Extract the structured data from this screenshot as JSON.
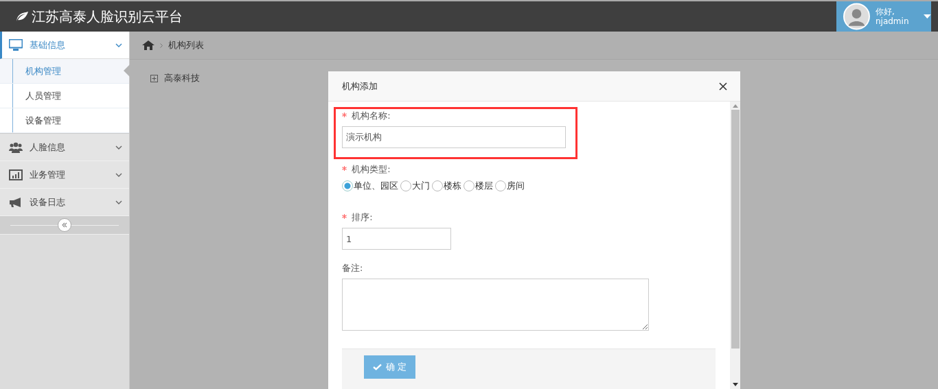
{
  "header": {
    "title": "江苏高泰人脸识别云平台",
    "greeting": "你好,",
    "username": "njadmin"
  },
  "sidebar": {
    "items": [
      {
        "label": "基础信息",
        "expanded": true,
        "children": [
          {
            "label": "机构管理",
            "selected": true
          },
          {
            "label": "人员管理",
            "selected": false
          },
          {
            "label": "设备管理",
            "selected": false
          }
        ]
      },
      {
        "label": "人脸信息",
        "expanded": false
      },
      {
        "label": "业务管理",
        "expanded": false
      },
      {
        "label": "设备日志",
        "expanded": false
      }
    ]
  },
  "breadcrumb": {
    "items": [
      "机构列表"
    ]
  },
  "tree": {
    "nodes": [
      {
        "label": "高泰科技",
        "expanded": false
      }
    ]
  },
  "dialog": {
    "title": "机构添加",
    "fields": [
      {
        "kind": "text",
        "label": "机构名称:",
        "required": true,
        "value": "演示机构",
        "highlighted": true
      },
      {
        "kind": "radio",
        "label": "机构类型:",
        "required": true,
        "options": [
          {
            "label": "单位、园区",
            "selected": true
          },
          {
            "label": "大门",
            "selected": false
          },
          {
            "label": "楼栋",
            "selected": false
          },
          {
            "label": "楼层",
            "selected": false
          },
          {
            "label": "房间",
            "selected": false
          }
        ]
      },
      {
        "kind": "short",
        "label": "排序:",
        "required": true,
        "value": "1"
      },
      {
        "kind": "textarea",
        "label": "备注:",
        "required": false
      }
    ],
    "submit": "确 定"
  }
}
